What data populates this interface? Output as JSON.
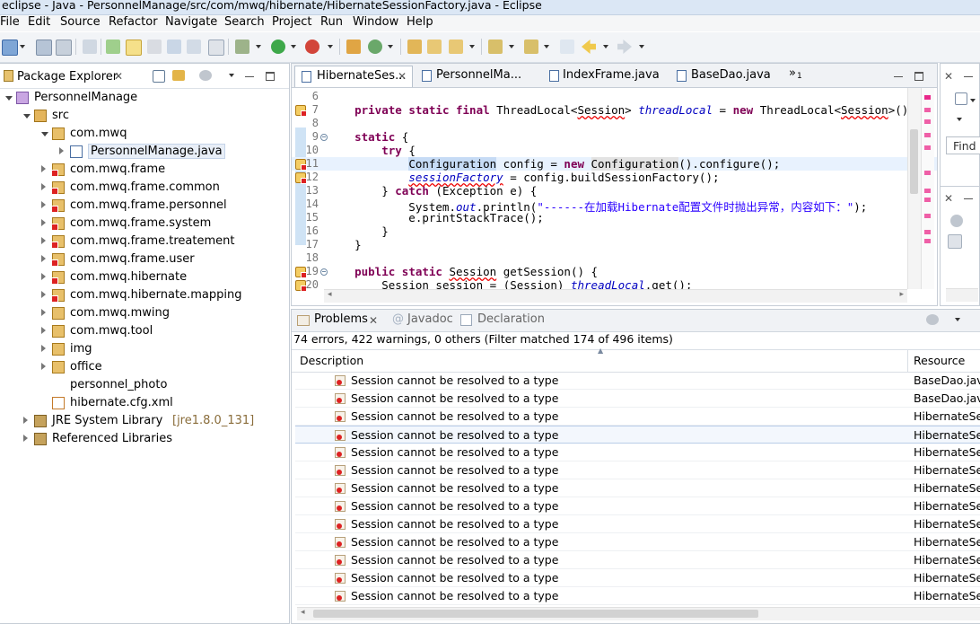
{
  "window": {
    "title": "eclipse - Java - PersonnelManage/src/com/mwq/hibernate/HibernateSessionFactory.java - Eclipse"
  },
  "menu": [
    "File",
    "Edit",
    "Source",
    "Refactor",
    "Navigate",
    "Search",
    "Project",
    "Run",
    "Window",
    "Help"
  ],
  "package_explorer": {
    "tab_label": "Package Explorer",
    "tree": [
      {
        "label": "PersonnelManage",
        "depth": 0,
        "expanded": true,
        "icon": "project-icon"
      },
      {
        "label": "src",
        "depth": 1,
        "expanded": true,
        "icon": "source-folder-icon"
      },
      {
        "label": "com.mwq",
        "depth": 2,
        "expanded": true,
        "icon": "package-icon"
      },
      {
        "label": "PersonnelManage.java",
        "depth": 3,
        "expanded": false,
        "icon": "java-file-icon",
        "selected": true
      },
      {
        "label": "com.mwq.frame",
        "depth": 2,
        "expanded": false,
        "icon": "package-error-icon"
      },
      {
        "label": "com.mwq.frame.common",
        "depth": 2,
        "expanded": false,
        "icon": "package-error-icon"
      },
      {
        "label": "com.mwq.frame.personnel",
        "depth": 2,
        "expanded": false,
        "icon": "package-error-icon"
      },
      {
        "label": "com.mwq.frame.system",
        "depth": 2,
        "expanded": false,
        "icon": "package-error-icon"
      },
      {
        "label": "com.mwq.frame.treatement",
        "depth": 2,
        "expanded": false,
        "icon": "package-error-icon"
      },
      {
        "label": "com.mwq.frame.user",
        "depth": 2,
        "expanded": false,
        "icon": "package-error-icon"
      },
      {
        "label": "com.mwq.hibernate",
        "depth": 2,
        "expanded": false,
        "icon": "package-error-icon"
      },
      {
        "label": "com.mwq.hibernate.mapping",
        "depth": 2,
        "expanded": false,
        "icon": "package-error-icon"
      },
      {
        "label": "com.mwq.mwing",
        "depth": 2,
        "expanded": false,
        "icon": "package-icon"
      },
      {
        "label": "com.mwq.tool",
        "depth": 2,
        "expanded": false,
        "icon": "package-icon"
      },
      {
        "label": "img",
        "depth": 2,
        "expanded": false,
        "icon": "package-icon"
      },
      {
        "label": "office",
        "depth": 2,
        "expanded": false,
        "icon": "package-icon"
      },
      {
        "label": "personnel_photo",
        "depth": 2,
        "expanded": null,
        "icon": "folder-icon"
      },
      {
        "label": "hibernate.cfg.xml",
        "depth": 2,
        "expanded": null,
        "icon": "xml-file-icon"
      },
      {
        "label": "JRE System Library",
        "suffix": "[jre1.8.0_131]",
        "depth": 1,
        "expanded": false,
        "icon": "library-icon"
      },
      {
        "label": "Referenced Libraries",
        "depth": 1,
        "expanded": false,
        "icon": "library-icon"
      }
    ]
  },
  "editor": {
    "tabs": [
      {
        "label": "HibernateSes...",
        "active": true,
        "closable": true
      },
      {
        "label": "PersonnelMa...",
        "active": false
      },
      {
        "label": "IndexFrame.java",
        "active": false
      },
      {
        "label": "BaseDao.java",
        "active": false
      }
    ],
    "overflow_label": "»",
    "overflow_count": "1",
    "lines": [
      {
        "num": "6",
        "html": ""
      },
      {
        "num": "7",
        "html": "    <span class=\"kw\">private static final</span> ThreadLocal&lt;<span class=\"sq\">Session</span>&gt; <span class=\"fi\">threadLocal</span> = <span class=\"kw\">new</span> ThreadLocal&lt;<span class=\"sq\">Session</span>&gt;();",
        "marker": true
      },
      {
        "num": "8",
        "html": ""
      },
      {
        "num": "9",
        "html": "    <span class=\"kw\">static</span> {",
        "fold": true
      },
      {
        "num": "10",
        "html": "        <span class=\"kw\">try</span> {"
      },
      {
        "num": "11",
        "html": "            <span class=\"hl\">Configuration</span> config = <span class=\"kw\">new</span> <span class=\"hl2\">Configuration</span>().configure();",
        "marker": true,
        "current": true
      },
      {
        "num": "12",
        "html": "            <span class=\"sq fi\">sessionFactory</span> = config.buildSessionFactory();",
        "marker": true
      },
      {
        "num": "13",
        "html": "        } <span class=\"kw\">catch</span> (Exception e) {"
      },
      {
        "num": "14",
        "html": "            System.<span class=\"fi\">out</span>.println(<span class=\"str\">\"------在加载Hibernate配置文件时抛出异常，内容如下：\"</span>);"
      },
      {
        "num": "15",
        "html": "            e.printStackTrace();"
      },
      {
        "num": "16",
        "html": "        }"
      },
      {
        "num": "17",
        "html": "    }"
      },
      {
        "num": "18",
        "html": ""
      },
      {
        "num": "19",
        "html": "    <span class=\"kw\">public static</span> <span class=\"sq\">Session</span> getSession() {",
        "marker": true,
        "fold": true
      },
      {
        "num": "20",
        "html": "        <span class=\"sq\">Session</span> session = (<span class=\"sq\">Session</span>) <span class=\"fi sq\">threadLocal</span>.get();",
        "marker": true
      }
    ]
  },
  "problems": {
    "tabs": [
      {
        "label": "Problems",
        "active": true
      },
      {
        "label": "Javadoc",
        "active": false
      },
      {
        "label": "Declaration",
        "active": false
      }
    ],
    "summary": "74 errors, 422 warnings, 0 others (Filter matched 174 of 496 items)",
    "columns": {
      "description": "Description",
      "resource": "Resource"
    },
    "rows": [
      {
        "description": "Session cannot be resolved to a type",
        "resource": "BaseDao.java"
      },
      {
        "description": "Session cannot be resolved to a type",
        "resource": "BaseDao.java"
      },
      {
        "description": "Session cannot be resolved to a type",
        "resource": "HibernateSes"
      },
      {
        "description": "Session cannot be resolved to a type",
        "resource": "HibernateSes",
        "selected": true
      },
      {
        "description": "Session cannot be resolved to a type",
        "resource": "HibernateSes"
      },
      {
        "description": "Session cannot be resolved to a type",
        "resource": "HibernateSes"
      },
      {
        "description": "Session cannot be resolved to a type",
        "resource": "HibernateSes"
      },
      {
        "description": "Session cannot be resolved to a type",
        "resource": "HibernateSes"
      },
      {
        "description": "Session cannot be resolved to a type",
        "resource": "HibernateSes"
      },
      {
        "description": "Session cannot be resolved to a type",
        "resource": "HibernateSes"
      },
      {
        "description": "Session cannot be resolved to a type",
        "resource": "HibernateSes"
      },
      {
        "description": "Session cannot be resolved to a type",
        "resource": "HibernateSes"
      },
      {
        "description": "Session cannot be resolved to a type",
        "resource": "HibernateSes"
      }
    ]
  },
  "right_panel": {
    "find_label": "Find"
  },
  "colors": {
    "accent": "#c6dbf5",
    "error": "#dd2222",
    "keyword": "#7f0055",
    "field": "#0000c0",
    "string": "#2a00ff"
  }
}
